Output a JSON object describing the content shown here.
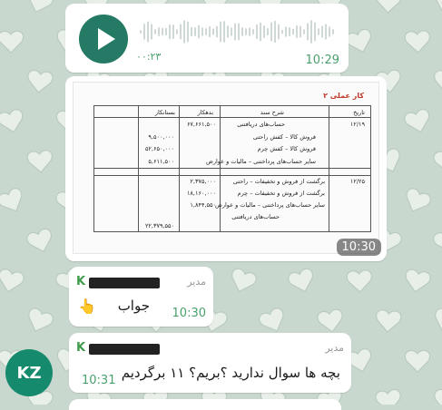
{
  "colors": {
    "wallpaper": "#c9d8cf",
    "bubble": "#ffffff",
    "time_text": "#4aa06d",
    "play_button": "#247a64",
    "sender_name": "#3f9c4c",
    "avatar": "#168a6c",
    "doc_title": "#c0392b"
  },
  "voice_message": {
    "duration": "۰۰:۲۳",
    "time": "10:29",
    "play_icon": "play-icon"
  },
  "image_message": {
    "time": "10:30",
    "document": {
      "title": "کار عملی ۲",
      "headers": {
        "date": "تاریخ",
        "description": "شرح سند",
        "debit": "بدهکار",
        "credit": "بستانکار"
      },
      "entry1": {
        "date": "۱۲/۱۹",
        "lines": [
          "حساب‌های دریافتنی",
          "فروش کالا – کفش راحتی",
          "فروش کالا – کفش چرم",
          "سایر حساب‌های پرداختنی – مالیات و عوارض"
        ],
        "debit": [
          "۶۷,۶۶۱,۵۰۰"
        ],
        "credit": [
          "۹,۵۰۰,۰۰۰",
          "۵۲,۶۵۰,۰۰۰",
          "۵,۶۱۱,۵۰۰"
        ]
      },
      "entry2": {
        "date": "۱۲/۲۵",
        "lines": [
          "برگشت از فروش و تخفیفات – راحتی",
          "برگشت از فروش و تخفیفات – چرم",
          "سایر حساب‌های پرداختنی – مالیات و عوارض",
          "حساب‌های دریافتنی"
        ],
        "debit": [
          "۲,۳۷۵,۰۰۰",
          "۱۸,۱۶۰,۰۰۰",
          "۱,۸۴۴,۵۵۰"
        ],
        "credit": [
          "۲۲,۳۷۹,۵۵۰"
        ]
      }
    }
  },
  "answer_message": {
    "role": "مدیر",
    "text": "جواب",
    "emoji": "👆",
    "time": "10:30"
  },
  "question_message": {
    "role": "مدیر",
    "text": "بچه ها سوال ندارید ؟بریم؟ ۱۱ برگردیم",
    "time": "10:31"
  },
  "avatar": {
    "initials": "KZ"
  }
}
